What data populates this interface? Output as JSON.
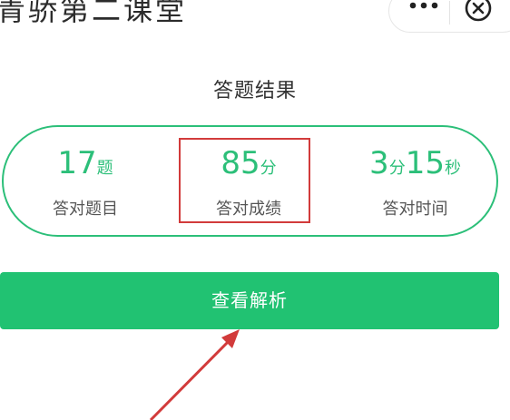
{
  "header": {
    "title": "青骄第二课堂",
    "more_icon": "more-dots-icon",
    "close_icon": "close-circle-icon"
  },
  "result": {
    "heading": "答题结果",
    "stats": [
      {
        "value": "17",
        "unit": "题",
        "label": "答对题目"
      },
      {
        "value": "85",
        "unit": "分",
        "label": "答对成绩"
      },
      {
        "value_min": "3",
        "unit_min": "分",
        "value_sec": "15",
        "unit_sec": "秒",
        "label": "答对时间"
      }
    ]
  },
  "actions": {
    "view_analysis_label": "查看解析"
  },
  "colors": {
    "accent": "#21c272",
    "highlight": "#d23b3b"
  }
}
